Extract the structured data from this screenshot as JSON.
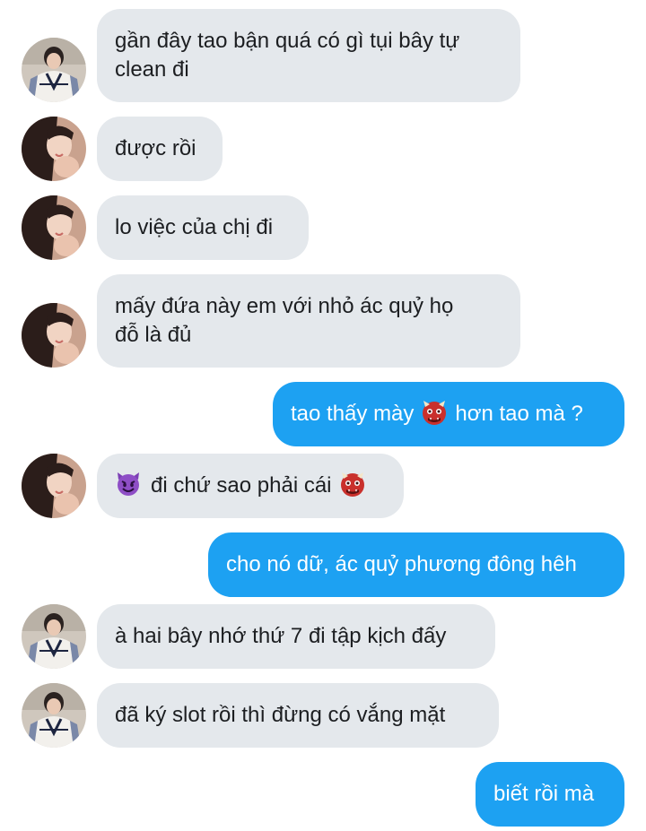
{
  "colors": {
    "incoming_bubble": "#e4e8ec",
    "outgoing_bubble": "#1da1f2",
    "incoming_text": "#1c1e21",
    "outgoing_text": "#ffffff"
  },
  "messages": [
    {
      "direction": "incoming",
      "avatar": "avatar-sweater",
      "text": "gần đây tao bận quá có gì tụi bây tự\nclean đi"
    },
    {
      "direction": "incoming",
      "avatar": "avatar-selfie",
      "text": "được rồi"
    },
    {
      "direction": "incoming",
      "avatar": "avatar-selfie",
      "text": "lo việc của chị đi"
    },
    {
      "direction": "incoming",
      "avatar": "avatar-selfie",
      "text": "mấy đứa này em với nhỏ ác quỷ họ\nđỗ là đủ"
    },
    {
      "direction": "outgoing",
      "text_before": "tao thấy mày",
      "emoji": "ogre-emoji",
      "text_after": "hơn tao mà ?"
    },
    {
      "direction": "incoming",
      "avatar": "avatar-selfie",
      "emoji_before": "smiling-imp-emoji",
      "text": "đi chứ sao phải cái",
      "emoji_after": "ogre-emoji"
    },
    {
      "direction": "outgoing",
      "text": "cho nó dữ, ác quỷ phương đông hêh"
    },
    {
      "direction": "incoming",
      "avatar": "avatar-sweater",
      "text": "à hai bây nhớ thứ 7 đi tập kịch đấy"
    },
    {
      "direction": "incoming",
      "avatar": "avatar-sweater",
      "text": "đã ký slot rồi thì đừng có vắng mặt"
    },
    {
      "direction": "outgoing",
      "text": "biết rồi mà"
    }
  ]
}
